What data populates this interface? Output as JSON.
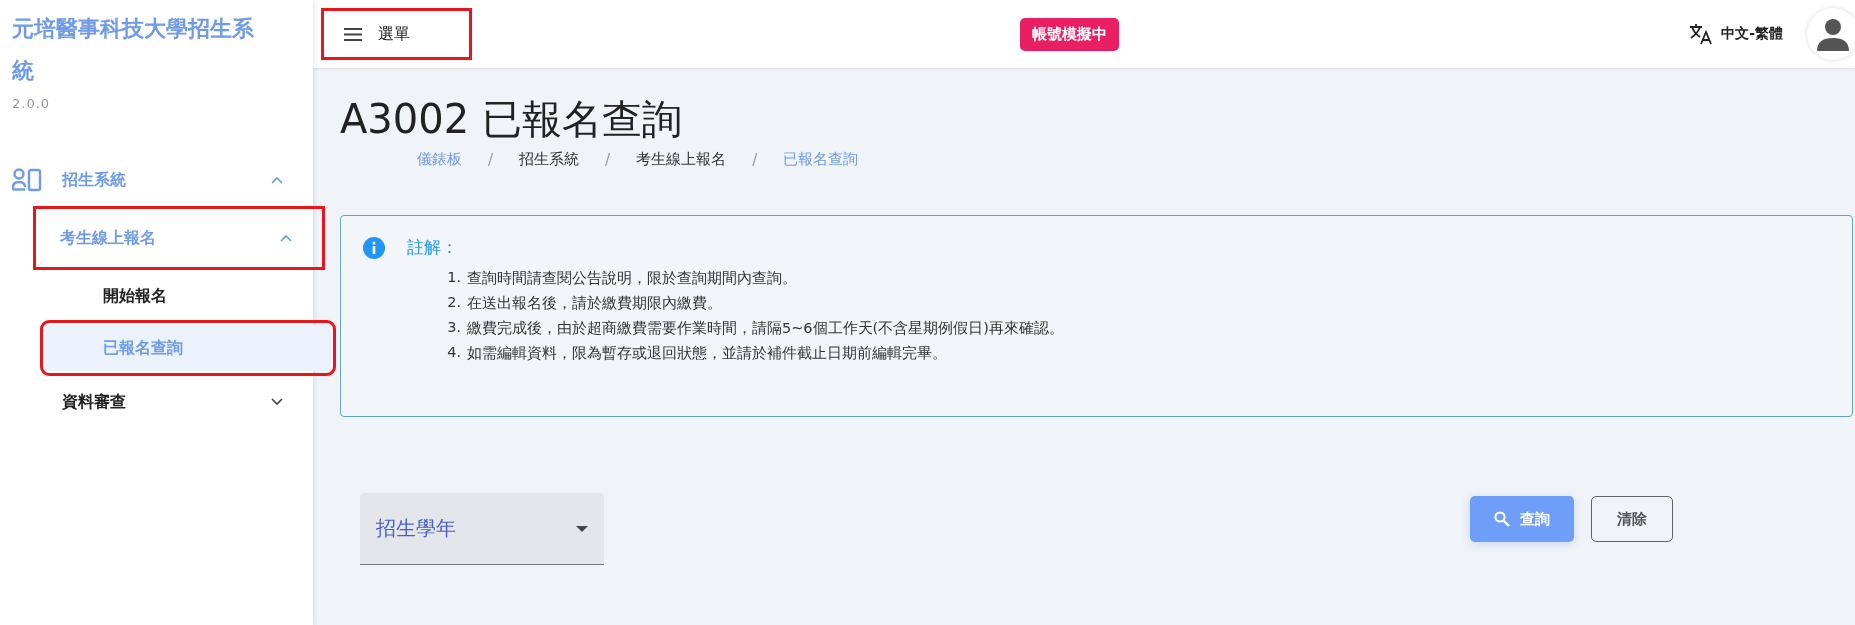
{
  "sidebar": {
    "title": "元培醫事科技大學招生系統",
    "version": "2.0.0",
    "items": [
      {
        "label": "招生系統",
        "kind": "group",
        "active": true,
        "expanded": true,
        "highlighted": false,
        "children": [
          {
            "label": "考生線上報名",
            "kind": "group",
            "active": true,
            "expanded": true,
            "highlighted": true,
            "children": [
              {
                "label": "開始報名",
                "kind": "leaf",
                "selected": false,
                "highlighted": false
              },
              {
                "label": "已報名查詢",
                "kind": "leaf",
                "selected": true,
                "highlighted": true
              }
            ]
          }
        ]
      },
      {
        "label": "資料審查",
        "kind": "group",
        "active": false,
        "expanded": false,
        "highlighted": false
      }
    ]
  },
  "topbar": {
    "menu_button": {
      "label": "選單",
      "highlighted": true
    },
    "status_badge": "帳號模擬中",
    "language": "中文-繁體"
  },
  "page": {
    "title": "A3002 已報名查詢",
    "breadcrumb": [
      {
        "label": "儀錶板",
        "kind": "link"
      },
      {
        "label": "/",
        "kind": "separator"
      },
      {
        "label": "招生系統",
        "kind": "text"
      },
      {
        "label": "/",
        "kind": "separator"
      },
      {
        "label": "考生線上報名",
        "kind": "text"
      },
      {
        "label": "/",
        "kind": "separator"
      },
      {
        "label": "已報名查詢",
        "kind": "link"
      }
    ],
    "notice": {
      "title": "註解：",
      "items": [
        {
          "number": "1.",
          "text": "查詢時間請查閱公告說明，限於查詢期間內查詢。"
        },
        {
          "number": "2.",
          "text": "在送出報名後，請於繳費期限內繳費。"
        },
        {
          "number": "3.",
          "text": "繳費完成後，由於超商繳費需要作業時間，請隔5~6個工作天(不含星期例假日)再來確認。"
        },
        {
          "number": "4.",
          "text": "如需編輯資料，限為暫存或退回狀態，並請於補件截止日期前編輯完畢。"
        }
      ]
    },
    "filter": {
      "select": {
        "label": "招生學年"
      }
    },
    "buttons": [
      {
        "label": "查詢",
        "kind": "primary"
      },
      {
        "label": "清除",
        "kind": "outline"
      }
    ]
  }
}
